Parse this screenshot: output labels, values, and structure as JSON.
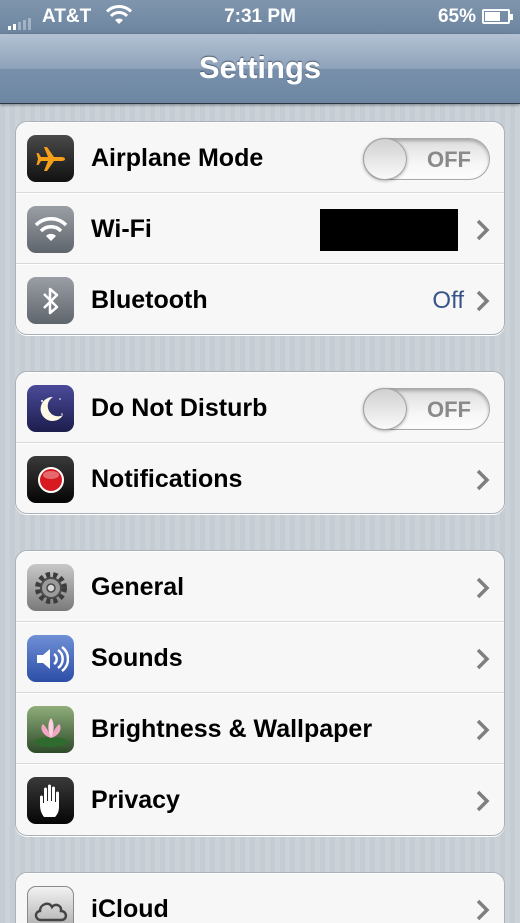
{
  "status_bar": {
    "carrier": "AT&T",
    "time": "7:31 PM",
    "battery": "65%",
    "battery_level": 0.65,
    "signal_bars": 2
  },
  "nav": {
    "title": "Settings"
  },
  "groups": [
    {
      "rows": [
        {
          "label": "Airplane Mode",
          "icon": "airplane-icon",
          "toggle": "OFF"
        },
        {
          "label": "Wi-Fi",
          "icon": "wifi-icon",
          "value": ""
        },
        {
          "label": "Bluetooth",
          "icon": "bluetooth-icon",
          "value": "Off"
        }
      ]
    },
    {
      "rows": [
        {
          "label": "Do Not Disturb",
          "icon": "moon-icon",
          "toggle": "OFF"
        },
        {
          "label": "Notifications",
          "icon": "notifications-icon"
        }
      ]
    },
    {
      "rows": [
        {
          "label": "General",
          "icon": "gear-icon"
        },
        {
          "label": "Sounds",
          "icon": "speaker-icon"
        },
        {
          "label": "Brightness & Wallpaper",
          "icon": "flower-icon"
        },
        {
          "label": "Privacy",
          "icon": "hand-icon"
        }
      ]
    },
    {
      "rows": [
        {
          "label": "iCloud",
          "icon": "cloud-icon"
        }
      ]
    }
  ],
  "colors": {
    "value_blue": "#385487",
    "nav_bar": "#7890ab",
    "background": "#c5ccd4"
  }
}
